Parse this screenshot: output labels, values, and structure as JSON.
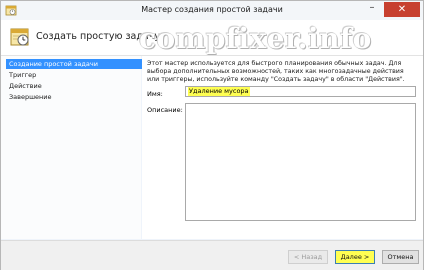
{
  "window": {
    "title": "Мастер создания простой задачи",
    "minimize_glyph": "–",
    "close_glyph": "✕"
  },
  "watermark": "compfixer.info",
  "header": {
    "title": "Создать простую задачу"
  },
  "sidebar": {
    "items": [
      {
        "label": "Создание простой задачи",
        "active": true
      },
      {
        "label": "Триггер",
        "active": false
      },
      {
        "label": "Действие",
        "active": false
      },
      {
        "label": "Завершение",
        "active": false
      }
    ]
  },
  "main": {
    "description": "Этот мастер используется для быстрого планирования обычных задач. Для выбора дополнительных возможностей, таких как многозадачные действия или триггеры, используйте команду \"Создать задачу\" в области \"Действия\".",
    "name_label": "Имя:",
    "name_value": "Удаление мусора",
    "description_label": "Описание:",
    "description_value": ""
  },
  "footer": {
    "back_label": "< Назад",
    "next_label": "Далее >",
    "cancel_label": "Отмена"
  },
  "colors": {
    "highlight": "#ffff52",
    "selection": "#3391ff",
    "close_button": "#c7402f"
  }
}
